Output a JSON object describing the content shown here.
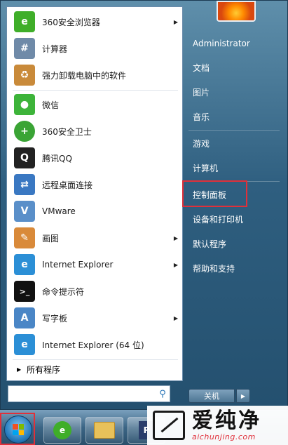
{
  "left_items": [
    {
      "label": "360安全浏览器",
      "icon": "360-browser-icon",
      "color": "#3fae29",
      "glyph": "e",
      "arrow": true
    },
    {
      "label": "计算器",
      "icon": "calculator-icon",
      "color": "#6f8aa8",
      "glyph": "#",
      "arrow": false
    },
    {
      "label": "强力卸载电脑中的软件",
      "icon": "uninstall-box-icon",
      "color": "#c98a3a",
      "glyph": "♻",
      "arrow": false
    },
    {
      "label": "微信",
      "icon": "wechat-icon",
      "color": "#3db43a",
      "glyph": "●",
      "arrow": false
    },
    {
      "label": "360安全卫士",
      "icon": "360-guard-icon",
      "color": "#3aa435",
      "glyph": "+",
      "arrow": false
    },
    {
      "label": "腾讯QQ",
      "icon": "qq-penguin-icon",
      "color": "#222222",
      "glyph": "Q",
      "arrow": false
    },
    {
      "label": "远程桌面连接",
      "icon": "remote-desktop-icon",
      "color": "#3a78c2",
      "glyph": "⇄",
      "arrow": false
    },
    {
      "label": "VMware",
      "icon": "vmware-icon",
      "color": "#5a8fc9",
      "glyph": "V",
      "arrow": false
    },
    {
      "label": "画图",
      "icon": "paint-palette-icon",
      "color": "#d98a3a",
      "glyph": "✎",
      "arrow": true
    },
    {
      "label": "Internet Explorer",
      "icon": "internet-explorer-icon",
      "color": "#2b8fd6",
      "glyph": "e",
      "arrow": true
    },
    {
      "label": "命令提示符",
      "icon": "command-prompt-icon",
      "color": "#111111",
      "glyph": ">",
      "arrow": false
    },
    {
      "label": "写字板",
      "icon": "wordpad-icon",
      "color": "#4a86c6",
      "glyph": "A",
      "arrow": true
    },
    {
      "label": "Internet Explorer (64 位)",
      "icon": "internet-explorer-icon",
      "color": "#2b8fd6",
      "glyph": "e",
      "arrow": false
    }
  ],
  "all_programs_label": "所有程序",
  "search": {
    "placeholder": "",
    "value": ""
  },
  "right_items": [
    {
      "label": "Administrator"
    },
    {
      "label": "文档"
    },
    {
      "label": "图片"
    },
    {
      "label": "音乐"
    },
    {
      "label": "游戏"
    },
    {
      "label": "计算机"
    },
    {
      "label": "控制面板"
    },
    {
      "label": "设备和打印机"
    },
    {
      "label": "默认程序"
    },
    {
      "label": "帮助和支持"
    }
  ],
  "shutdown_label": "关机",
  "watermark": {
    "brand": "爱纯净",
    "url": "aichunjing.com"
  },
  "colors": {
    "highlight": "#e0303a",
    "menu_bg": "#2f5f80"
  }
}
